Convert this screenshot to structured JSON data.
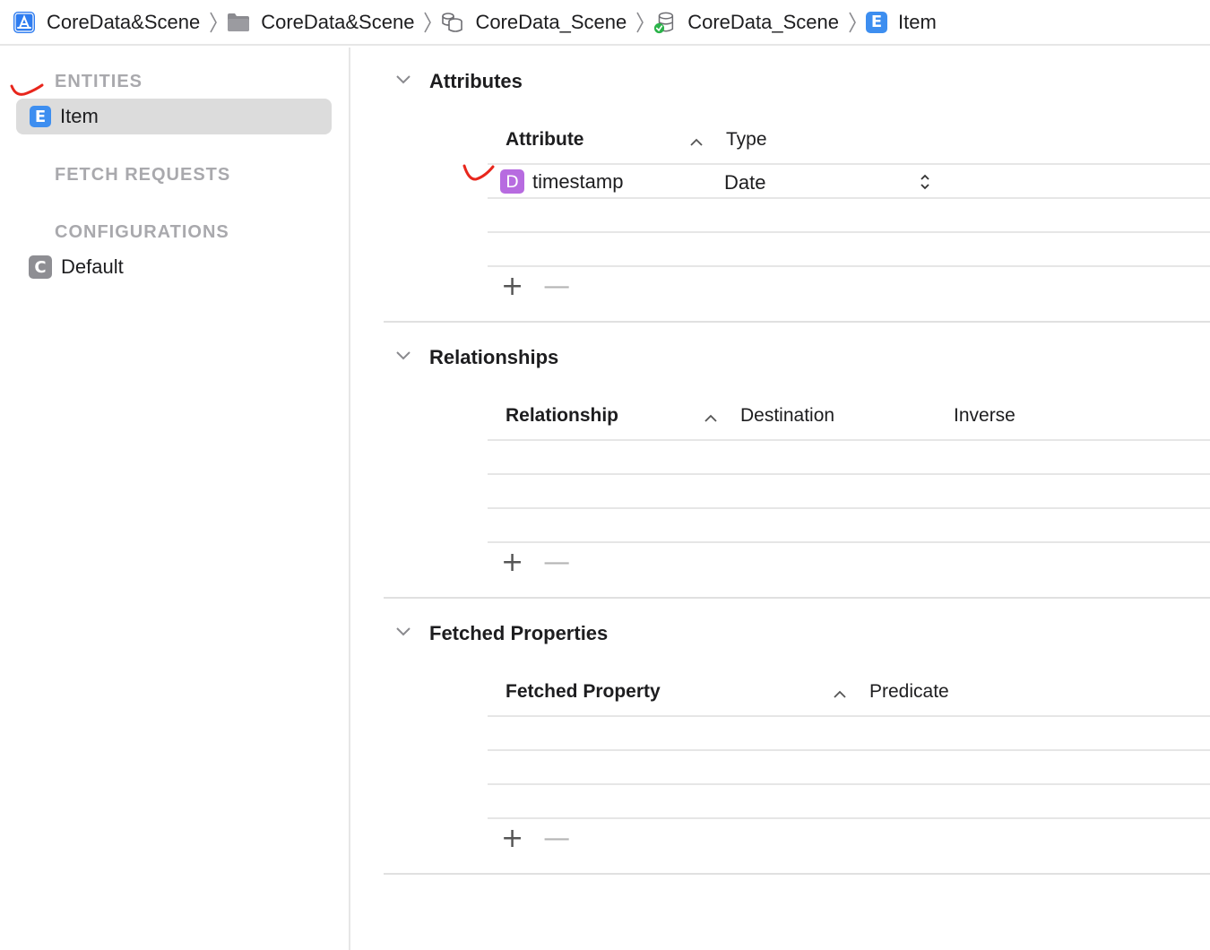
{
  "breadcrumb": [
    {
      "label": "CoreData&Scene",
      "icon": "app-project-icon"
    },
    {
      "label": "CoreData&Scene",
      "icon": "folder-icon"
    },
    {
      "label": "CoreData_Scene",
      "icon": "data-model-bundle-icon"
    },
    {
      "label": "CoreData_Scene",
      "icon": "data-model-version-icon"
    },
    {
      "label": "Item",
      "icon": "entity-icon",
      "badge": "E"
    }
  ],
  "sidebar": {
    "entities_heading": "ENTITIES",
    "entities": [
      {
        "label": "Item",
        "badge": "E"
      }
    ],
    "fetch_requests_heading": "FETCH REQUESTS",
    "configurations_heading": "CONFIGURATIONS",
    "configurations": [
      {
        "label": "Default",
        "badge": "C"
      }
    ]
  },
  "attributes": {
    "title": "Attributes",
    "col_attribute": "Attribute",
    "col_type": "Type",
    "rows": [
      {
        "name": "timestamp",
        "badge": "D",
        "type": "Date"
      }
    ]
  },
  "relationships": {
    "title": "Relationships",
    "col_relationship": "Relationship",
    "col_destination": "Destination",
    "col_inverse": "Inverse"
  },
  "fetched": {
    "title": "Fetched Properties",
    "col_property": "Fetched Property",
    "col_predicate": "Predicate"
  },
  "controls": {
    "plus": "+",
    "minus": "—"
  },
  "colors": {
    "entity_badge": "#3d8ef0",
    "date_badge": "#b76be0",
    "config_badge": "#8e8e93",
    "annotation": "#e8261c",
    "selection": "#dcdcdc"
  }
}
